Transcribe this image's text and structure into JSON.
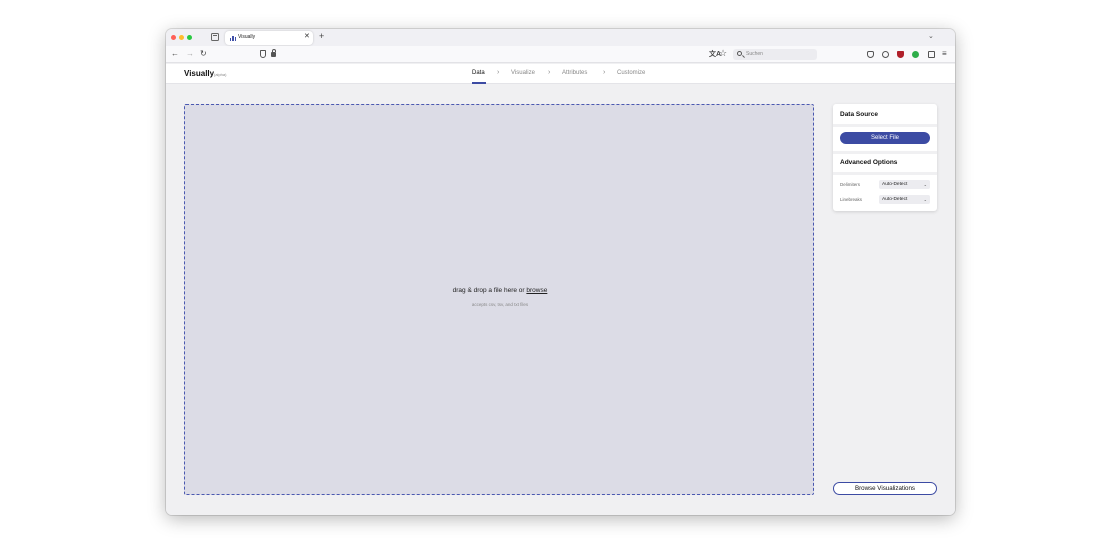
{
  "browser": {
    "tab_title": "Visually",
    "tab_close": "✕",
    "new_tab": "+",
    "tab_list": "⌄",
    "back": "←",
    "forward": "→",
    "reload": "↻",
    "translate": "文A",
    "star": "☆",
    "search_placeholder": "Suchen",
    "menu": "≡"
  },
  "app": {
    "logo": "Visually",
    "logo_sub": "(alpha)",
    "steps": [
      "Data",
      "Visualize",
      "Attributes",
      "Customize"
    ],
    "active_step": "Data",
    "chevron": "›"
  },
  "dropzone": {
    "text_before": "drag & drop a file here or ",
    "browse": "browse",
    "subtext": "accepts csv, tsv, and txt files"
  },
  "panel": {
    "data_source_title": "Data Source",
    "select_file_label": "Select File",
    "advanced_title": "Advanced Options",
    "options": [
      {
        "label": "Delimiters",
        "value": "Auto-Detect"
      },
      {
        "label": "Linebreaks",
        "value": "Auto-Detect"
      }
    ],
    "caret": "⌄"
  },
  "browse_visualizations_label": "Browse Visualizations",
  "colors": {
    "accent": "#3c4ba3",
    "dropzone_bg": "#dcdce6"
  }
}
